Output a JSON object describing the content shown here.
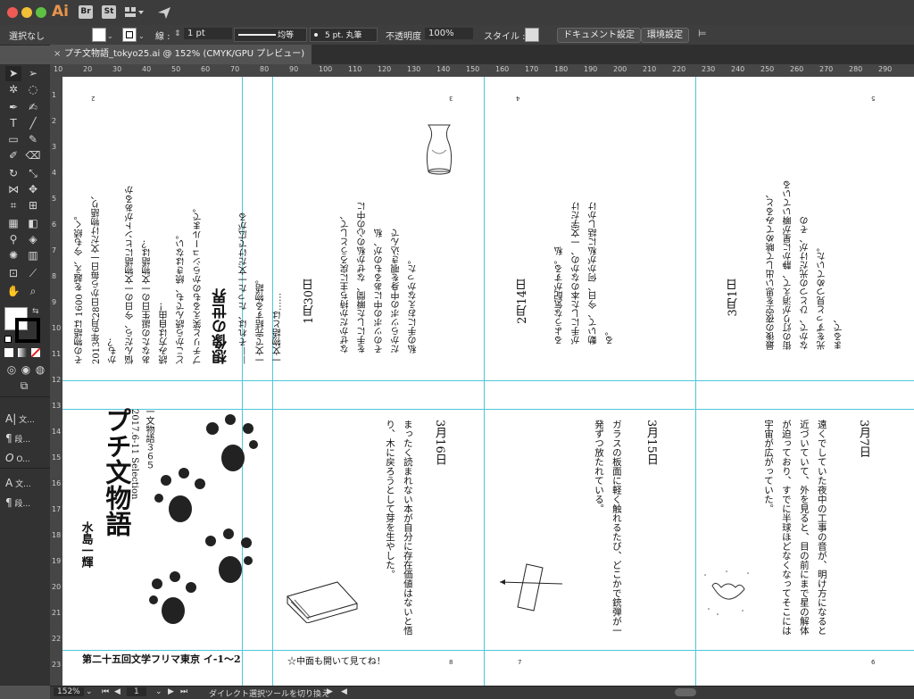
{
  "app": {
    "logo": "Ai"
  },
  "titlebar": {
    "br_label": "Br",
    "st_label": "St"
  },
  "control": {
    "selection": "選択なし",
    "stroke_label": "線 :",
    "stroke_value": "1 pt",
    "profile_label": "均等",
    "brush_label": "5 pt. 丸筆",
    "opacity_label": "不透明度 :",
    "opacity_value": "100%",
    "style_label": "スタイル :",
    "doc_settings": "ドキュメント設定",
    "prefs": "環境設定"
  },
  "tab": {
    "title": "プチ文物語_tokyo25.ai @ 152% (CMYK/GPU プレビュー)"
  },
  "panels": [
    {
      "label": "文..."
    },
    {
      "label": "段..."
    },
    {
      "label": "O..."
    },
    {
      "label": "文..."
    },
    {
      "label": "段..."
    }
  ],
  "ruler": {
    "top": [
      "10",
      "20",
      "30",
      "40",
      "50",
      "60",
      "70",
      "80",
      "90",
      "100",
      "110",
      "120",
      "130",
      "140",
      "150",
      "160",
      "170",
      "180",
      "190",
      "200",
      "210",
      "220",
      "230",
      "240",
      "250",
      "260",
      "270",
      "280",
      "290"
    ],
    "left": [
      "1",
      "2",
      "3",
      "4",
      "5",
      "6",
      "7",
      "8",
      "9",
      "10",
      "11",
      "12",
      "13",
      "14",
      "15",
      "16",
      "17",
      "18",
      "19",
      "20",
      "21",
      "22",
      "23"
    ]
  },
  "doc": {
    "p2": {
      "page_num": "2",
      "lines": [
        "その物語は 1600 を越え、今も続く。",
        "2013年6月28日から毎日一文だけ物語り、",
        "かも？",
        "悩んだら、今日の一文物語にヒントがあるか",
        "あなたの誕生日の一文物語は？",
        "読み方は自由！",
        "どこから読んでも、続きはない。",
        "プチリと笑えるものからシュールまで。",
        "",
        "想像の世界",
        "——それは、たった一文だけで広がる",
        "一文で完結する物語。",
        "一文物語とは……"
      ]
    },
    "p3": {
      "page_num": "3",
      "date": "1月30日",
      "lines": [
        "なぜかだか持ち主に戻ろうとして、",
        "を手にした瞬間、なぜか私の心の中に",
        "そのツボの中にあるものが、私",
        "だからツボの中身を覗き込んで",
        "私の手におえなかった。"
      ]
    },
    "p4": {
      "page_num": "4",
      "date": "2月14日",
      "lines": [
        "るような気配がする。私",
        "が手にした本のなかの、一文字だけ",
        "動いて、今日、何かが私に話しかけ",
        "る。"
      ]
    },
    "p5": {
      "page_num": "5",
      "date": "3月1日",
      "lines": [
        "最後の夜空を思い出して眺めてみると、",
        "街の灯りが消えて、静かに星が瞬いている",
        "なかで、ひとつの光だけが、その",
        "光をずっと見つめていた。",
        "まるで、"
      ]
    },
    "p6": {
      "page_num": "6",
      "date": "3月7日",
      "lines": [
        "遠くでしていた夜中の工事の音が、明け方になると",
        "近づいていて、外を見ると、目の前にまで星の解体",
        "が迫っており、すでに半球ほどなくなってそこには",
        "宇宙が広がっていた。"
      ]
    },
    "p7": {
      "page_num": "7",
      "date": "3月15日",
      "lines": [
        "ガラスの板面に軽く触れるたび、どこかで銃弾が一",
        "発ずつ放たれている。"
      ]
    },
    "p8": {
      "page_num": "8",
      "date": "3月16日",
      "lines": [
        "まったく読まれない本が自分に存在価値はないと悟",
        "り、木に戻ろうとして芽を生やした。"
      ],
      "footer": "☆中面も開いて見てね！"
    },
    "cover": {
      "title": "プチ文物語",
      "subtitle": "一文物語３６５",
      "range": "2017.6-11 Selection",
      "author": "水島一輝",
      "event": "第二十五回文学フリマ東京 イ-1～2"
    }
  },
  "status": {
    "zoom": "152%",
    "page": "1",
    "tool_hint": "ダイレクト選択ツールを切り換え"
  }
}
